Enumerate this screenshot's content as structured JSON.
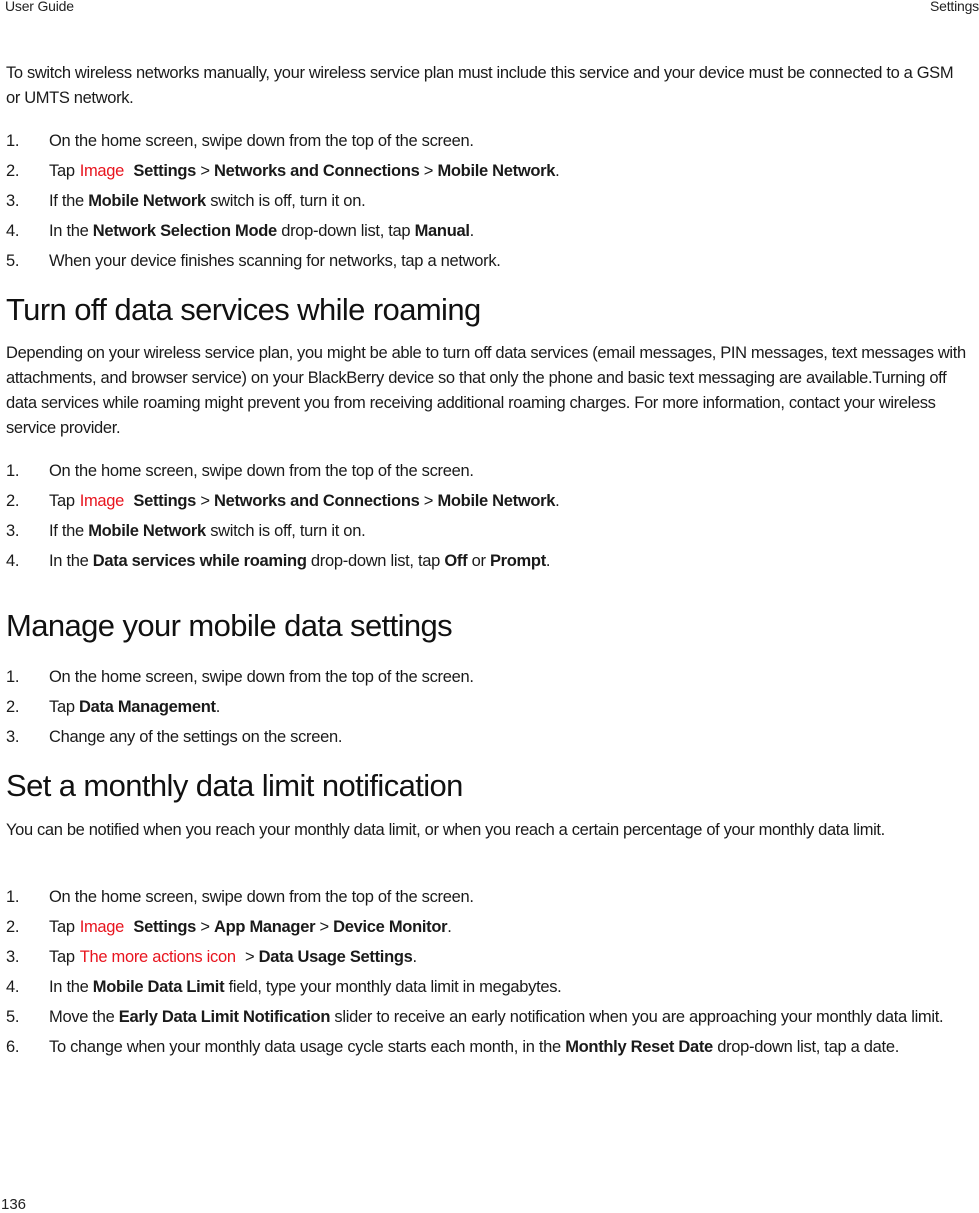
{
  "header": {
    "left": "User Guide",
    "right": "Settings"
  },
  "footer": {
    "page_number": "136"
  },
  "sections": {
    "intro": {
      "paragraph": "To switch wireless networks manually, your wireless service plan must include this service and your device must be connected to a GSM or UMTS network.",
      "steps": [
        {
          "num": "1.",
          "text": "On the home screen, swipe down from the top of the screen."
        },
        {
          "num": "2.",
          "tap": "Tap",
          "icon_alt": "Image",
          "b1": "Settings",
          "sep1": ">",
          "b2": "Networks and Connections",
          "sep2": ">",
          "b3": "Mobile Network",
          "end": "."
        },
        {
          "num": "3.",
          "pre": "If the",
          "b1": "Mobile Network",
          "post": "switch is off, turn it on."
        },
        {
          "num": "4.",
          "pre": "In the",
          "b1": "Network Selection Mode",
          "mid": "drop-down list, tap",
          "b2": "Manual",
          "end": "."
        },
        {
          "num": "5.",
          "text": "When your device finishes scanning for networks, tap a network."
        }
      ]
    },
    "roaming": {
      "title": "Turn off data services while roaming",
      "paragraph": "Depending on your wireless service plan, you might be able to turn off data services (email messages, PIN messages, text messages with attachments, and browser service) on your BlackBerry device so that only the phone and basic text messaging are available.Turning off data services while roaming might prevent you from receiving additional roaming charges. For more information, contact your wireless service provider.",
      "steps": [
        {
          "num": "1.",
          "text": "On the home screen, swipe down from the top of the screen."
        },
        {
          "num": "2.",
          "tap": "Tap",
          "icon_alt": "Image",
          "b1": "Settings",
          "sep1": ">",
          "b2": "Networks and Connections",
          "sep2": ">",
          "b3": "Mobile Network",
          "end": "."
        },
        {
          "num": "3.",
          "pre": "If the",
          "b1": "Mobile Network",
          "post": "switch is off, turn it on."
        },
        {
          "num": "4.",
          "pre": "In the",
          "b1": "Data services while roaming",
          "mid": "drop-down list, tap",
          "b2": "Off",
          "or": "or",
          "b3": "Prompt",
          "end": "."
        }
      ]
    },
    "manage": {
      "title": "Manage your mobile data settings",
      "steps": [
        {
          "num": "1.",
          "text": "On the home screen, swipe down from the top of the screen."
        },
        {
          "num": "2.",
          "pre": "Tap",
          "b1": "Data Management",
          "end": "."
        },
        {
          "num": "3.",
          "text": "Change any of the settings on the screen."
        }
      ]
    },
    "limit": {
      "title": "Set a monthly data limit notification",
      "paragraph": "You can be notified when you reach your monthly data limit, or when you reach a certain percentage of your monthly data limit.",
      "steps": [
        {
          "num": "1.",
          "text": "On the home screen, swipe down from the top of the screen."
        },
        {
          "num": "2.",
          "tap": "Tap",
          "icon_alt": "Image",
          "b1": "Settings",
          "sep1": ">",
          "b2": "App Manager",
          "sep2": ">",
          "b3": "Device Monitor",
          "end": "."
        },
        {
          "num": "3.",
          "tap": "Tap",
          "icon_alt": "The more actions icon",
          "sep1": ">",
          "b1": "Data Usage Settings",
          "end": "."
        },
        {
          "num": "4.",
          "pre": "In the",
          "b1": "Mobile Data Limit",
          "post": "field, type your monthly data limit in megabytes."
        },
        {
          "num": "5.",
          "pre": "Move the",
          "b1": "Early Data Limit Notification",
          "post": "slider to receive an early notification when you are approaching your monthly data limit."
        },
        {
          "num": "6.",
          "pre": "To change when your monthly data usage cycle starts each month, in the",
          "b1": "Monthly Reset Date",
          "post": "drop-down list, tap a date."
        }
      ]
    }
  }
}
